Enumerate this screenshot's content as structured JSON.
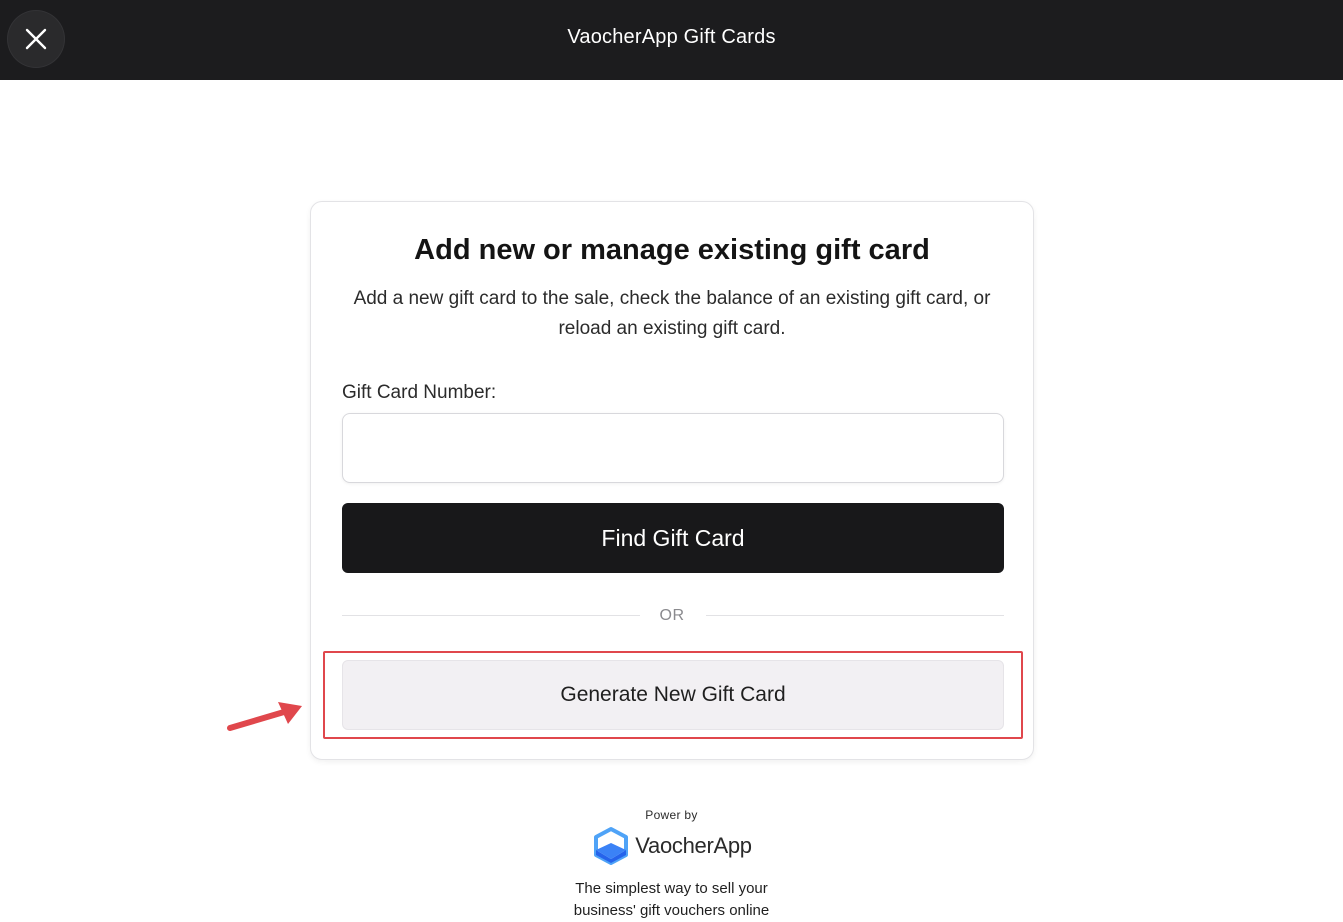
{
  "header": {
    "title": "VaocherApp Gift Cards",
    "close_icon": "close-icon"
  },
  "card": {
    "title": "Add new or manage existing gift card",
    "description": "Add a new gift card to the sale, check the balance of an existing gift card, or reload an existing gift card.",
    "field_label": "Gift Card Number:",
    "field_value": "",
    "field_placeholder": "",
    "find_button": "Find Gift Card",
    "divider": "OR",
    "generate_button": "Generate New Gift Card"
  },
  "annotation": {
    "highlight_color": "#e0474c",
    "arrow_icon": "red-arrow-icon"
  },
  "footer": {
    "powered_by": "Power by",
    "brand": "VaocherApp",
    "brand_icon": "vaocherapp-logo-icon",
    "tagline_line1": "The simplest way to sell your",
    "tagline_line2": "business' gift vouchers online"
  },
  "colors": {
    "topbar": "#1c1c1e",
    "primary_button": "#18181a",
    "secondary_button": "#f2f0f3",
    "brand_blue": "#3b82f6"
  }
}
